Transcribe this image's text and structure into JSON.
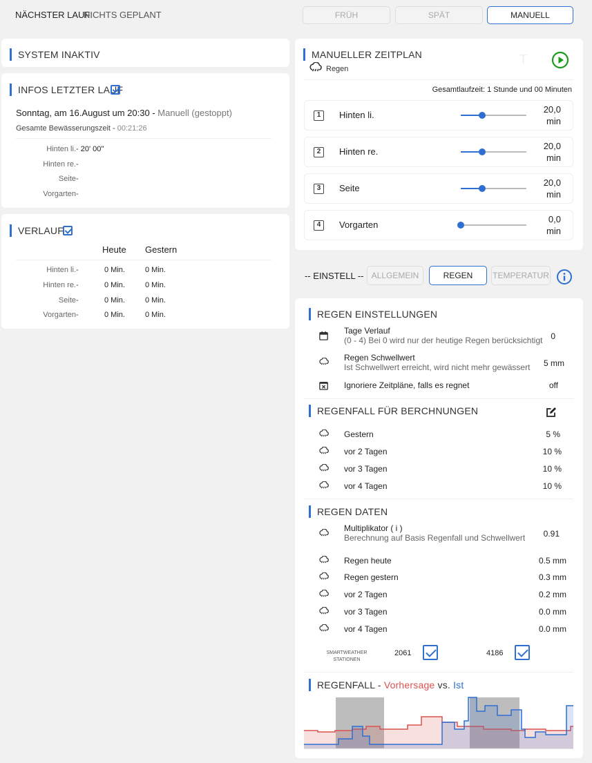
{
  "header": {
    "next_run_label": "NÄCHSTER LAUF:",
    "next_run_value": "NICHTS GEPLANT",
    "buttons": [
      "FRÜH",
      "SPÄT",
      "MANUELL"
    ]
  },
  "system": {
    "title": "SYSTEM INAKTIV"
  },
  "last_run": {
    "title": "INFOS LETZTER LAUF",
    "date": "Sonntag, am 16.August um 20:30",
    "mode": "Manuell (gestoppt)",
    "total_label": "Gesamte Bewässerungszeit",
    "total_value": "00:21:26",
    "zones": [
      {
        "name": "Hinten li.",
        "value": "20' 00''"
      },
      {
        "name": "Hinten re.",
        "value": ""
      },
      {
        "name": "Seite",
        "value": ""
      },
      {
        "name": "Vorgarten",
        "value": ""
      }
    ]
  },
  "history": {
    "title": "VERLAUF",
    "col_today": "Heute",
    "col_yesterday": "Gestern",
    "rows": [
      {
        "name": "Hinten li.",
        "today": "0 Min.",
        "yesterday": "0 Min."
      },
      {
        "name": "Hinten re.",
        "today": "0 Min.",
        "yesterday": "0 Min."
      },
      {
        "name": "Seite",
        "today": "0 Min.",
        "yesterday": "0 Min."
      },
      {
        "name": "Vorgarten",
        "today": "0 Min.",
        "yesterday": "0 Min."
      }
    ]
  },
  "manual": {
    "title": "MANUELLER ZEITPLAN",
    "subtitle": "Regen",
    "total_runtime": "Gesamtlaufzeit: 1 Stunde und 00 Minuten",
    "zones": [
      {
        "num": "1",
        "name": "Hinten li.",
        "value": "20,0",
        "unit": "min",
        "level": 0.33
      },
      {
        "num": "2",
        "name": "Hinten re.",
        "value": "20,0",
        "unit": "min",
        "level": 0.33
      },
      {
        "num": "3",
        "name": "Seite",
        "value": "20,0",
        "unit": "min",
        "level": 0.33
      },
      {
        "num": "4",
        "name": "Vorgarten",
        "value": "0,0",
        "unit": "min",
        "level": 0.0
      }
    ]
  },
  "settings_tabs": {
    "label": "-- EINSTELL --",
    "tabs": [
      "ALLGEMEIN",
      "REGEN",
      "TEMPERATUR"
    ]
  },
  "rain_settings": {
    "title": "REGEN EINSTELLUNGEN",
    "rows": [
      {
        "label": "Tage Verlauf",
        "sub": "(0 - 4) Bei 0 wird nur der heutige Regen berücksichtigt",
        "value": "0"
      },
      {
        "label": "Regen Schwellwert",
        "sub": "Ist Schwellwert erreicht, wird nicht mehr gewässert",
        "value": "5 mm"
      },
      {
        "label": "Ignoriere Zeitpläne, falls es regnet",
        "sub": "",
        "value": "off"
      }
    ]
  },
  "rainfall_calc": {
    "title": "REGENFALL FÜR BERCHNUNGEN",
    "rows": [
      {
        "label": "Gestern",
        "value": "5 %"
      },
      {
        "label": "vor 2 Tagen",
        "value": "10 %"
      },
      {
        "label": "vor 3 Tagen",
        "value": "10 %"
      },
      {
        "label": "vor 4 Tagen",
        "value": "10 %"
      }
    ]
  },
  "rain_data": {
    "title": "REGEN DATEN",
    "multiplier_label": "Multiplikator ( i )",
    "multiplier_sub": "Berechnung auf Basis Regenfall und Schwellwert",
    "multiplier_value": "0.91",
    "rows": [
      {
        "label": "Regen heute",
        "value": "0.5 mm"
      },
      {
        "label": "Regen gestern",
        "value": "0.3 mm"
      },
      {
        "label": "vor 2 Tagen",
        "value": "0.2 mm"
      },
      {
        "label": "vor 3 Tagen",
        "value": "0.0 mm"
      },
      {
        "label": "vor 4 Tagen",
        "value": "0.0 mm"
      }
    ],
    "stations_label_1": "SMARTWEATHER",
    "stations_label_2": "STATIONEN",
    "station_1": "2061",
    "station_2": "4186"
  },
  "forecast": {
    "title_prefix": "REGENFALL - ",
    "title_forecast": "Vorhersage",
    "title_vs": " vs. ",
    "title_actual": "Ist"
  },
  "colors": {
    "accent": "#2e6fd1",
    "forecast": "#d9534f",
    "actual": "#2e6fd1",
    "play": "#1a9a1a"
  },
  "icons": [
    "cloud-rain-icon",
    "play-circle-icon",
    "info-circle-icon",
    "calendar-icon",
    "calendar-x-icon",
    "edit-icon"
  ]
}
